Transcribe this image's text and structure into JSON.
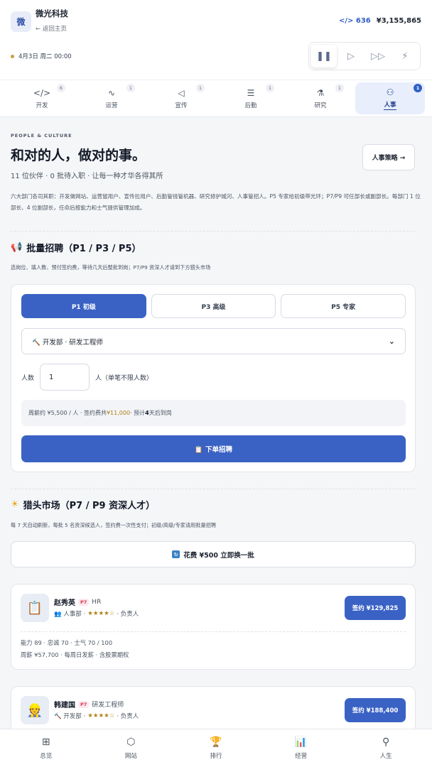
{
  "header": {
    "logo_char": "微",
    "company": "微光科技",
    "back_link": "← 返回主页",
    "code_stat": "</> 636",
    "money_stat": "¥3,155,865",
    "date": "4月3日 周二 00:00",
    "controls": [
      "❚❚",
      "▷",
      "▷▷",
      "⚡"
    ]
  },
  "tabs": [
    {
      "label": "开发",
      "badge": "6",
      "icon": "</>"
    },
    {
      "label": "运营",
      "badge": "1",
      "icon": "∿"
    },
    {
      "label": "宣传",
      "badge": "1",
      "icon": "◁"
    },
    {
      "label": "后勤",
      "badge": "1",
      "icon": "☰"
    },
    {
      "label": "研究",
      "badge": "1",
      "icon": "⚗"
    },
    {
      "label": "人事",
      "badge": "1",
      "icon": "⚇"
    }
  ],
  "intro": {
    "eyebrow": "PEOPLE & CULTURE",
    "headline": "和对的人，做对的事。",
    "subline": "11 位伙伴 · 0 批待入职 · 让每一种才华各得其所",
    "strategy_button": "人事策略 →",
    "description": "六大部门各司其职：开发做网站、运营留用户、宣传拉用户、后勤管钱管机器、研究修护城河、人事管招人。P5 专家给初级带光环；P7/P9 可任部长或副部长。每部门 1 位部长、4 位副部长，任命后按能力和士气提供管理加成。"
  },
  "batch": {
    "icon": "📢",
    "title": "批量招聘（P1 / P3 / P5）",
    "subtitle": "选岗位、填人数、预付签约费，等待几天后整批到岗；P7/P9 资深人才请到下方猎头市场",
    "levels": [
      "P1 初级",
      "P3 高级",
      "P5 专家"
    ],
    "selected_position": "🔨 开发部 · 研发工程师",
    "count_label": "人数",
    "count_value": "1",
    "count_unit": "人（单笔不限人数）",
    "summary_prefix": "周薪约 ¥5,500 / 人 · 签约费共 ",
    "summary_fee": "¥11,000",
    "summary_mid": " · 预计 ",
    "summary_days": "4",
    "summary_suffix": " 天后到岗",
    "order_button": "📋 下单招聘"
  },
  "headhunter": {
    "icon": "☀",
    "title": "猎头市场（P7 / P9 资深人才）",
    "subtitle": "每 7 天自动刷新，每批 5 名资深候选人，签约费一次性支付；初级/高级/专家请用批量招聘",
    "refresh_icon": "↻",
    "refresh_button": "花费 ¥500 立即换一批"
  },
  "candidates": [
    {
      "avatar": "📋",
      "name": "赵秀英",
      "level": "P7",
      "role": "HR",
      "dept": "👥 人事部 · ",
      "stars": "★★★★☆",
      "dept_suffix": " · 负责人",
      "sign_button": "签约 ¥129,825",
      "attrs": "能力 89 · 忠诚 70 · 士气 70 / 100",
      "salary": "周薪 ¥57,700 · 每周日发薪 · 含股票期权"
    },
    {
      "avatar": "👷",
      "name": "韩建国",
      "level": "P7",
      "role": "研发工程师",
      "dept": "🔨 开发部 · ",
      "stars": "★★★★☆",
      "dept_suffix": " · 负责人",
      "sign_button": "签约 ¥188,400",
      "attrs": "",
      "salary": ""
    }
  ],
  "bottom_nav": [
    {
      "label": "总览",
      "icon": "⊞"
    },
    {
      "label": "网站",
      "icon": "⬡"
    },
    {
      "label": "排行",
      "icon": "🏆"
    },
    {
      "label": "经营",
      "icon": "📊"
    },
    {
      "label": "人生",
      "icon": "⚲"
    }
  ]
}
